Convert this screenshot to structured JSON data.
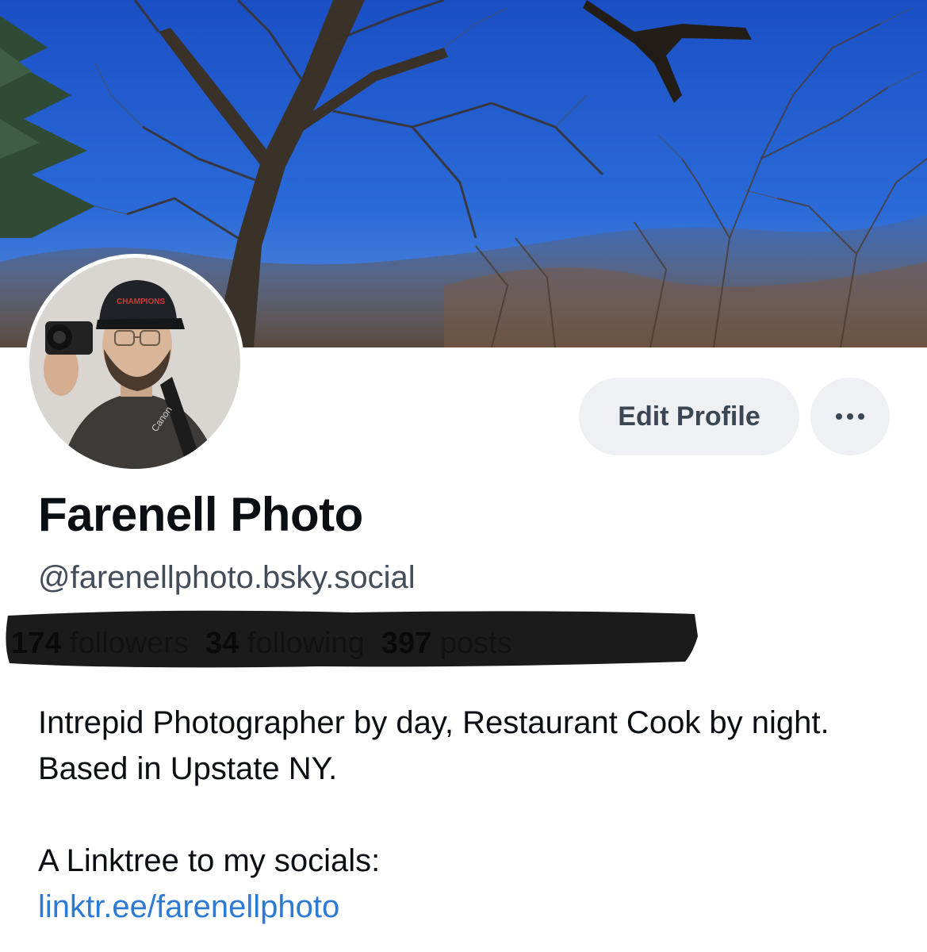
{
  "profile": {
    "display_name": "Farenell Photo",
    "handle": "@farenellphoto.bsky.social",
    "stats": {
      "followers_count": "174",
      "followers_label": "followers",
      "following_count": "34",
      "following_label": "following",
      "posts_count": "397",
      "posts_label": "posts"
    },
    "bio": {
      "line1": "Intrepid Photographer by day, Restaurant Cook by night. Based in Upstate NY.",
      "line2": "A Linktree to my socials:",
      "link": "linktr.ee/farenellphoto"
    }
  },
  "avatar": {
    "cap_text": "CHAMPIONS",
    "strap_text": "Canon"
  },
  "actions": {
    "edit_profile_label": "Edit Profile",
    "more_icon": "ellipsis-icon"
  },
  "colors": {
    "sky": "#1d56c9",
    "button_bg": "#eef0f3",
    "link": "#2d7ad6",
    "redaction": "#0a0a0a"
  }
}
